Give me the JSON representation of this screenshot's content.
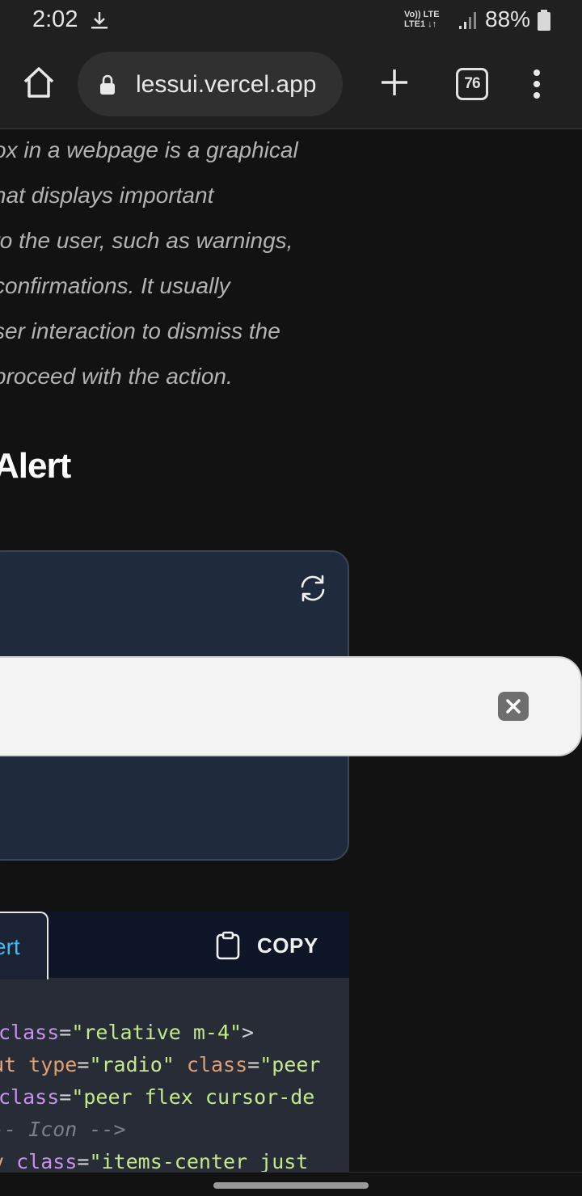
{
  "status_bar": {
    "time": "2:02",
    "network_line1": "Vo)) LTE",
    "network_line2": "LTE1 ↓↑",
    "battery": "88%"
  },
  "browser": {
    "url": "lessui.vercel.app",
    "tab_count": "76"
  },
  "content": {
    "paragraph_lines": [
      "ox in a webpage is a graphical",
      "hat displays important",
      " to the user, such as warnings,",
      "confirmations. It usually",
      "ser interaction to dismiss the",
      "proceed with the action."
    ],
    "heading": "Alert"
  },
  "code_panel": {
    "tab_label": "ert",
    "copy_label": "COPY",
    "lines": [
      [
        {
          "t": "class",
          "c": "attr"
        },
        {
          "t": "=",
          "c": "plain"
        },
        {
          "t": "\"relative m-4\"",
          "c": "str"
        },
        {
          "t": ">",
          "c": "plain"
        }
      ],
      [
        {
          "t": "ut ",
          "c": "tag"
        },
        {
          "t": "type",
          "c": "attr2"
        },
        {
          "t": "=",
          "c": "plain"
        },
        {
          "t": "\"radio\"",
          "c": "str"
        },
        {
          "t": " ",
          "c": "plain"
        },
        {
          "t": "class",
          "c": "attr2"
        },
        {
          "t": "=",
          "c": "plain"
        },
        {
          "t": "\"peer",
          "c": "str"
        }
      ],
      [
        {
          "t": "class",
          "c": "attr"
        },
        {
          "t": "=",
          "c": "plain"
        },
        {
          "t": "\"peer flex cursor-de",
          "c": "str"
        }
      ],
      [
        {
          "t": "-- Icon -->",
          "c": "comment"
        }
      ],
      [
        {
          "t": "v ",
          "c": "tag"
        },
        {
          "t": "class",
          "c": "attr"
        },
        {
          "t": "=",
          "c": "plain"
        },
        {
          "t": "\"items-center just",
          "c": "str"
        }
      ]
    ]
  },
  "colors": {
    "page_bg": "#121212",
    "card_bg": "#1f2a3c",
    "alert_bg": "#f3f3f3",
    "accent": "#38bdf8"
  }
}
